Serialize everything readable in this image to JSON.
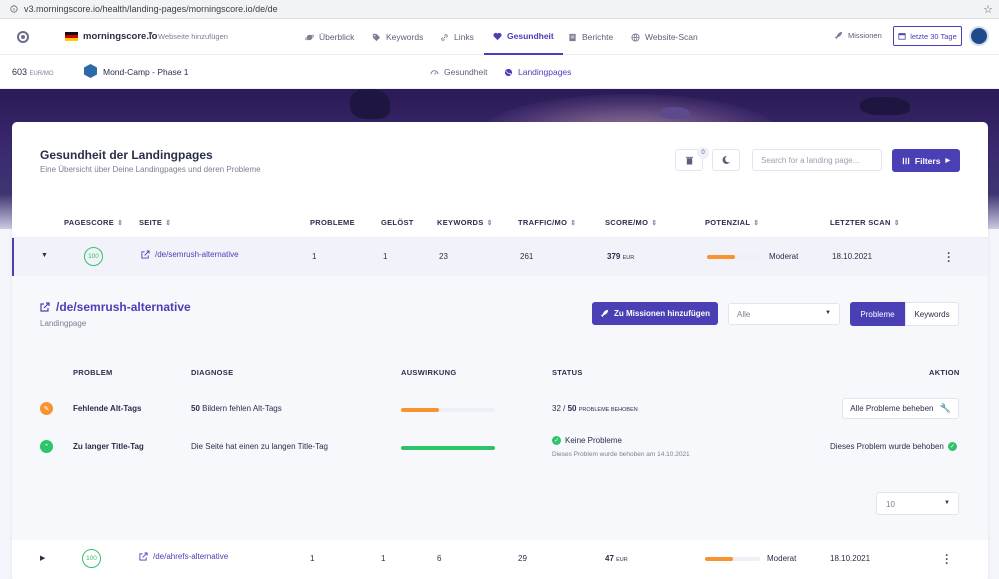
{
  "browser": {
    "url": "v3.morningscore.io/health/landing-pages/morningscore.io/de/de"
  },
  "topnav": {
    "site": "morningscore.io",
    "add_site": "Webseite hinzufügen",
    "items": [
      {
        "label": "Überblick",
        "icon": "planet-icon"
      },
      {
        "label": "Keywords",
        "icon": "tag-icon"
      },
      {
        "label": "Links",
        "icon": "link-icon"
      },
      {
        "label": "Gesundheit",
        "icon": "heart-icon"
      },
      {
        "label": "Berichte",
        "icon": "report-icon"
      },
      {
        "label": "Website-Scan",
        "icon": "globe-icon"
      }
    ],
    "missions": "Missionen",
    "date_range": "letzte 30 Tage"
  },
  "subnav": {
    "value": "603",
    "value_unit": "EUR/MO",
    "project": "Mond-Camp - Phase 1",
    "tabs": [
      {
        "label": "Gesundheit"
      },
      {
        "label": "Landingpages"
      }
    ]
  },
  "card": {
    "title": "Gesundheit der Landingpages",
    "subtitle": "Eine Übersicht über Deine Landingpages und deren Probleme",
    "trash_count": "0",
    "search_placeholder": "Search for a landing page...",
    "filters_label": "Filters"
  },
  "table": {
    "headers": {
      "pagescore": "PAGESCORE",
      "seite": "SEITE",
      "probleme": "PROBLEME",
      "geloest": "GELÖST",
      "keywords": "KEYWORDS",
      "traffic": "TRAFFIC/MO",
      "score": "SCORE/MO",
      "potenzial": "POTENZIAL",
      "scan": "LETZTER SCAN"
    },
    "rows": [
      {
        "pagescore": "100",
        "page": "/de/semrush-alternative",
        "problems": "1",
        "solved": "1",
        "keywords": "23",
        "traffic": "261",
        "score": "379",
        "score_unit": "EUR",
        "potential": "Moderat",
        "potential_fill": 0.5,
        "last_scan": "18.10.2021"
      },
      {
        "pagescore": "100",
        "page": "/de/ahrefs-alternative",
        "problems": "1",
        "solved": "1",
        "keywords": "6",
        "traffic": "29",
        "score": "47",
        "score_unit": "EUR",
        "potential": "Moderat",
        "potential_fill": 0.5,
        "last_scan": "18.10.2021"
      }
    ]
  },
  "detail": {
    "title": "/de/semrush-alternative",
    "subtitle": "Landingpage",
    "mission_button": "Zu Missionen hinzufügen",
    "filter_select": "Alle",
    "toggle_problems": "Probleme",
    "toggle_keywords": "Keywords",
    "headers": {
      "problem": "PROBLEM",
      "diagnose": "DIAGNOSE",
      "impact": "AUSWIRKUNG",
      "status": "STATUS",
      "action": "AKTION"
    },
    "problems": [
      {
        "name": "Fehlende Alt-Tags",
        "diagnose_count": "50",
        "diagnose_text": "Bildern fehlen Alt-Tags",
        "impact_fill": 0.4,
        "impact_color": "#f7942f",
        "status_done": "32",
        "status_sep": "/",
        "status_total": "50",
        "status_suffix": "PROBLEME BEHOBEN",
        "action": "Alle Probleme beheben"
      },
      {
        "name": "Zu langer Title-Tag",
        "diagnose_text": "Die Seite hat einen zu langen Title-Tag",
        "impact_fill": 1.0,
        "impact_color": "#2fc36a",
        "status_title": "Keine Probleme",
        "status_note": "Dieses Problem wurde behoben am 14.10.2021",
        "action": "Dieses Problem wurde behoben"
      }
    ],
    "page_size": "10"
  },
  "colors": {
    "accent": "#4a3fb4",
    "success": "#2fc36a",
    "warning": "#f7942f"
  }
}
